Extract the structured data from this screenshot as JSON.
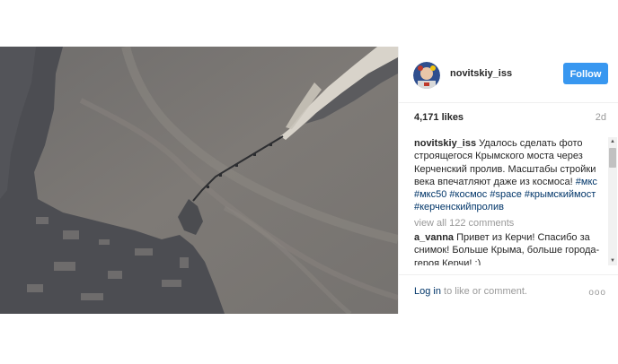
{
  "post": {
    "username": "novitskiy_iss",
    "follow_label": "Follow",
    "likes": "4,171 likes",
    "age": "2d",
    "caption": {
      "user": "novitskiy_iss",
      "text": "Удалось сделать фото строящегося Крымского моста через Керченский пролив. Масштабы стройки века впечатляют даже из космоса!",
      "hashtags": [
        "#мкс",
        "#мкс50",
        "#космос",
        "#space",
        "#крымскиймост",
        "#керченскийпролив"
      ]
    },
    "view_all": "view all 122 comments",
    "comment": {
      "user": "a_vanna",
      "text": "Привет из Керчи! Спасибо за снимок! Больше Крыма, больше города-героя Керчи! :)"
    },
    "footer": {
      "login_link": "Log in",
      "login_rest": " to like or comment.",
      "more": "ooo"
    }
  },
  "colors": {
    "follow_bg": "#3897f0",
    "link": "#003569",
    "muted": "#999999",
    "sea": "#7a7774",
    "land": "#4a4b4f"
  },
  "icons": {
    "more": "more-options-icon",
    "scroll_up": "scroll-up-arrow-icon",
    "scroll_down": "scroll-down-arrow-icon"
  }
}
